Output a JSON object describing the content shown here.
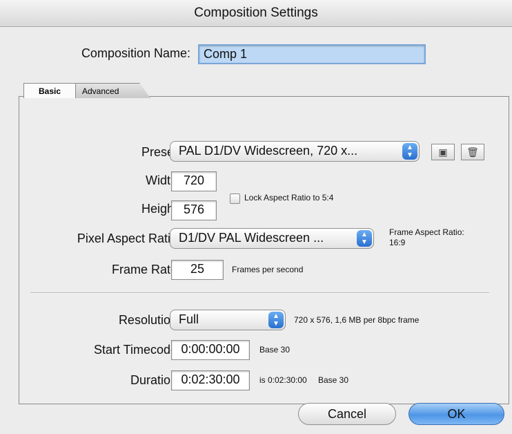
{
  "window": {
    "title": "Composition Settings"
  },
  "comp_name": {
    "label": "Composition Name:",
    "value": "Comp 1"
  },
  "tabs": [
    {
      "label": "Basic"
    },
    {
      "label": "Advanced"
    }
  ],
  "preset": {
    "label": "Preset:",
    "value": "PAL D1/DV Widescreen, 720 x..."
  },
  "width": {
    "label": "Width:",
    "value": "720"
  },
  "height": {
    "label": "Height:",
    "value": "576"
  },
  "lock_aspect": {
    "label": "Lock Aspect Ratio to 5:4",
    "checked": false
  },
  "pixel_aspect": {
    "label": "Pixel Aspect Ratio:",
    "value": "D1/DV PAL Widescreen ..."
  },
  "frame_aspect": {
    "label": "Frame Aspect Ratio:",
    "value": "16:9"
  },
  "frame_rate": {
    "label": "Frame Rate:",
    "value": "25",
    "unit": "Frames per second"
  },
  "resolution": {
    "label": "Resolution:",
    "value": "Full",
    "info": "720 x 576, 1,6 MB per 8bpc frame"
  },
  "start_timecode": {
    "label": "Start Timecode:",
    "value": "0:00:00:00",
    "base": "Base 30"
  },
  "duration": {
    "label": "Duration:",
    "value": "0:02:30:00",
    "info": "is 0:02:30:00",
    "base": "Base 30"
  },
  "buttons": {
    "cancel": "Cancel",
    "ok": "OK"
  },
  "icons": {
    "save_preset": "save-icon",
    "delete_preset": "trash-icon",
    "stepper": "up-down-arrows-icon"
  }
}
